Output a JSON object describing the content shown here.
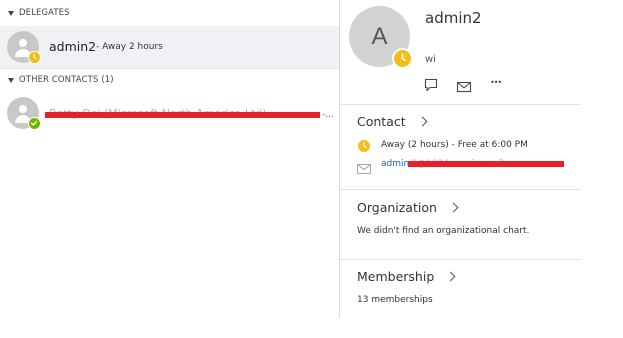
{
  "delegates": {
    "header": "DELEGATES",
    "contact": {
      "name": "admin2",
      "status": "- Away 2 hours",
      "presence": "away"
    }
  },
  "other_contacts": {
    "header": "OTHER CONTACTS",
    "count": "(1)",
    "contact": {
      "name_redacted": "Betty Ooi (Microsoft North America Ltd)",
      "trailing": "-...",
      "presence": "available"
    }
  },
  "profile": {
    "initial": "A",
    "name": "admin2",
    "note": "wi",
    "presence": "away"
  },
  "actions": {
    "chat_icon": "chat-icon",
    "mail_icon": "mail-icon",
    "more_label": "•••"
  },
  "contact_section": {
    "title": "Contact",
    "status": "Away (2 hours) - Free at 6:00 PM",
    "email_visible": "admin",
    "email_redacted": "2@1234.onmicrosoft.com"
  },
  "organization_section": {
    "title": "Organization",
    "text": "We didn't find an organizational chart."
  },
  "membership_section": {
    "title": "Membership",
    "text": "13 memberships"
  },
  "colors": {
    "away": "#f4bd1a",
    "available": "#6bb700",
    "link": "#1b5fa8",
    "redaction": "#e8202a",
    "selected_row": "#f0f1f4"
  }
}
